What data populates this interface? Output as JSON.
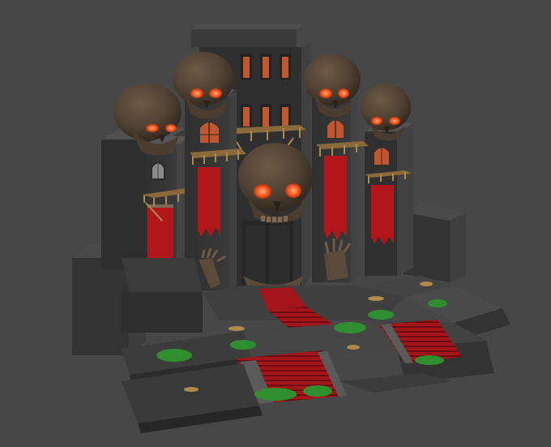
{
  "scene": {
    "kind": "3d-render",
    "background_color": "#474747",
    "palette": {
      "stone_dark": "#2b2b2b",
      "stone_mid": "#3a3a3a",
      "stone_light": "#4b4b4b",
      "banner_red": "#b0161a",
      "carpet_red": "#a3151a",
      "slime_green": "#2f8f2f",
      "skull_bone": "#5a4a3a",
      "skull_shadow": "#3b2f25",
      "eye_glow": "#ff6a2a",
      "window_glow": "#c2562e",
      "brass": "#b08a4a"
    },
    "objects": [
      "central-tower",
      "giant-skull",
      "left-tower-skull",
      "right-tower-skull",
      "outer-left-tower-skull",
      "outer-right-tower-skull",
      "red-banners",
      "skeletal-hands",
      "central-stairway",
      "lower-left-stairs",
      "lower-right-stairs",
      "courtyard-walls",
      "balconies",
      "windows"
    ]
  }
}
